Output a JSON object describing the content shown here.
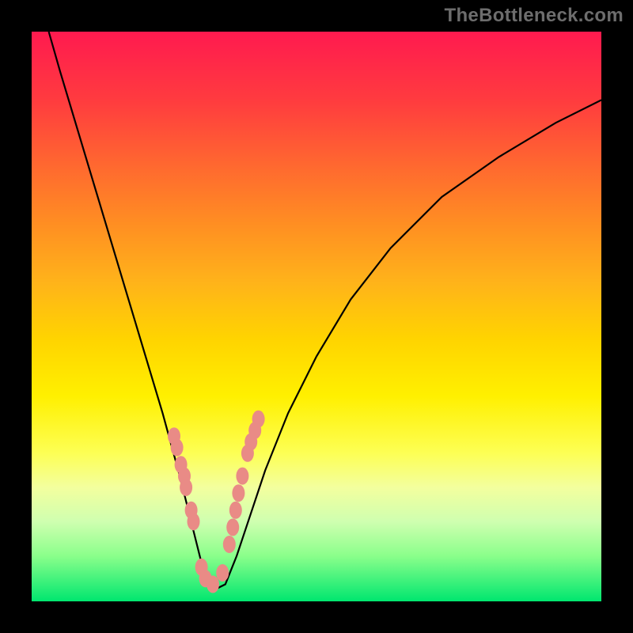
{
  "watermark": "TheBottleneck.com",
  "chart_data": {
    "type": "line",
    "title": "",
    "xlabel": "",
    "ylabel": "",
    "xlim": [
      0,
      100
    ],
    "ylim": [
      0,
      100
    ],
    "grid": false,
    "legend": false,
    "series": [
      {
        "name": "bottleneck-curve",
        "color": "#000000",
        "x": [
          3,
          5,
          8,
          11,
          14,
          17,
          20,
          23,
          26,
          28,
          29,
          30,
          31,
          32,
          34,
          36,
          38,
          41,
          45,
          50,
          56,
          63,
          72,
          82,
          92,
          100
        ],
        "y": [
          100,
          93,
          83,
          73,
          63,
          53,
          43,
          33,
          22,
          14,
          10,
          6,
          3,
          2,
          3,
          8,
          14,
          23,
          33,
          43,
          53,
          62,
          71,
          78,
          84,
          88
        ]
      },
      {
        "name": "datapoint-markers",
        "color": "#e98b86",
        "marker": true,
        "x": [
          25.0,
          25.5,
          26.2,
          26.8,
          27.1,
          28.0,
          28.4,
          29.8,
          30.5,
          31.8,
          33.5,
          34.7,
          35.3,
          35.8,
          36.3,
          37.0,
          37.9,
          38.5,
          39.2,
          39.8
        ],
        "y": [
          29,
          27,
          24,
          22,
          20,
          16,
          14,
          6,
          4,
          3,
          5,
          10,
          13,
          16,
          19,
          22,
          26,
          28,
          30,
          32
        ]
      }
    ],
    "background_gradient": {
      "top": "#ff1a4f",
      "bottom": "#00e66f"
    }
  }
}
